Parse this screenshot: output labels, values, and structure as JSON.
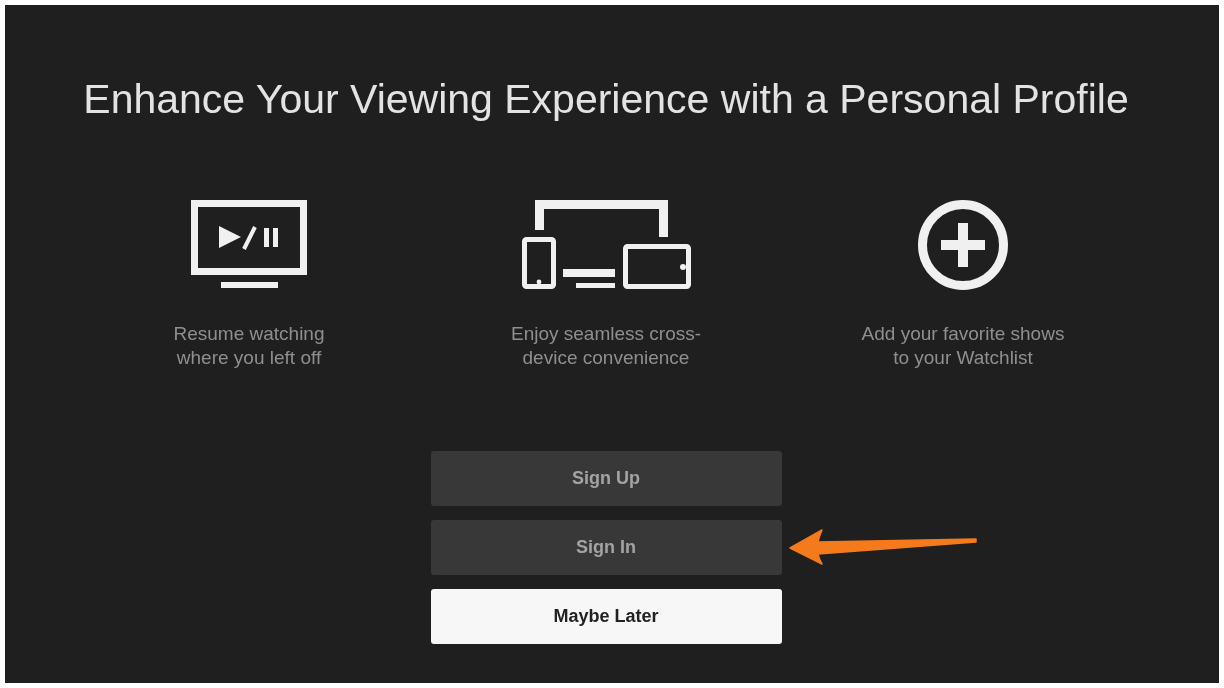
{
  "title": "Enhance Your Viewing Experience with a Personal Profile",
  "features": [
    {
      "kind": "playback",
      "text": "Resume watching\nwhere you left off"
    },
    {
      "kind": "devices",
      "text": "Enjoy seamless cross-\ndevice convenience"
    },
    {
      "kind": "add",
      "text": "Add your favorite shows\nto your Watchlist"
    }
  ],
  "buttons": [
    {
      "label": "Sign Up",
      "selected": false,
      "arrow": false
    },
    {
      "label": "Sign In",
      "selected": false,
      "arrow": true
    },
    {
      "label": "Maybe Later",
      "selected": true,
      "arrow": false
    }
  ]
}
